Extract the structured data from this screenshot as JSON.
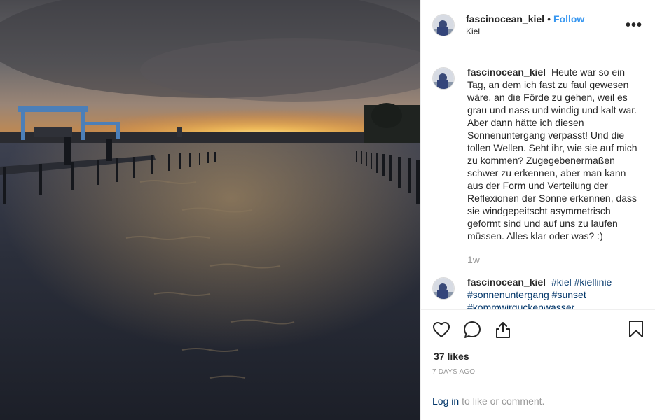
{
  "header": {
    "username": "fascinocean_kiel",
    "separator": "•",
    "follow_label": "Follow",
    "location": "Kiel",
    "more_label": "•••"
  },
  "caption": {
    "username": "fascinocean_kiel",
    "text": "Heute war so ein Tag, an dem ich fast zu faul gewesen wäre, an die Förde zu gehen, weil es grau und nass und windig und kalt war. Aber dann hätte ich diesen Sonnenuntergang verpasst! Und die tollen Wellen. Seht ihr, wie sie auf mich zu kommen? Zugegebenermaßen schwer zu erkennen, aber man kann aus der Form und Verteilung der Reflexionen der Sonne erkennen, dass sie windgepeitscht asymmetrisch geformt sind und auf uns zu laufen müssen. Alles klar oder was? :)",
    "age": "1w"
  },
  "hashtag_comment": {
    "username": "fascinocean_kiel",
    "tags": [
      "#kiel",
      "#kiellinie",
      "#sonnenuntergang",
      "#sunset",
      "#kommwirguckenwasser"
    ]
  },
  "actions": {
    "like_icon": "heart-icon",
    "comment_icon": "comment-icon",
    "share_icon": "share-icon",
    "save_icon": "bookmark-icon"
  },
  "likes_text": "37 likes",
  "time_ago": "7 DAYS AGO",
  "login": {
    "link_label": "Log in",
    "rest_label": "to like or comment."
  },
  "colors": {
    "link_blue": "#3897f0",
    "hashtag_blue": "#003569",
    "muted_gray": "#999999",
    "border": "#efefef"
  }
}
